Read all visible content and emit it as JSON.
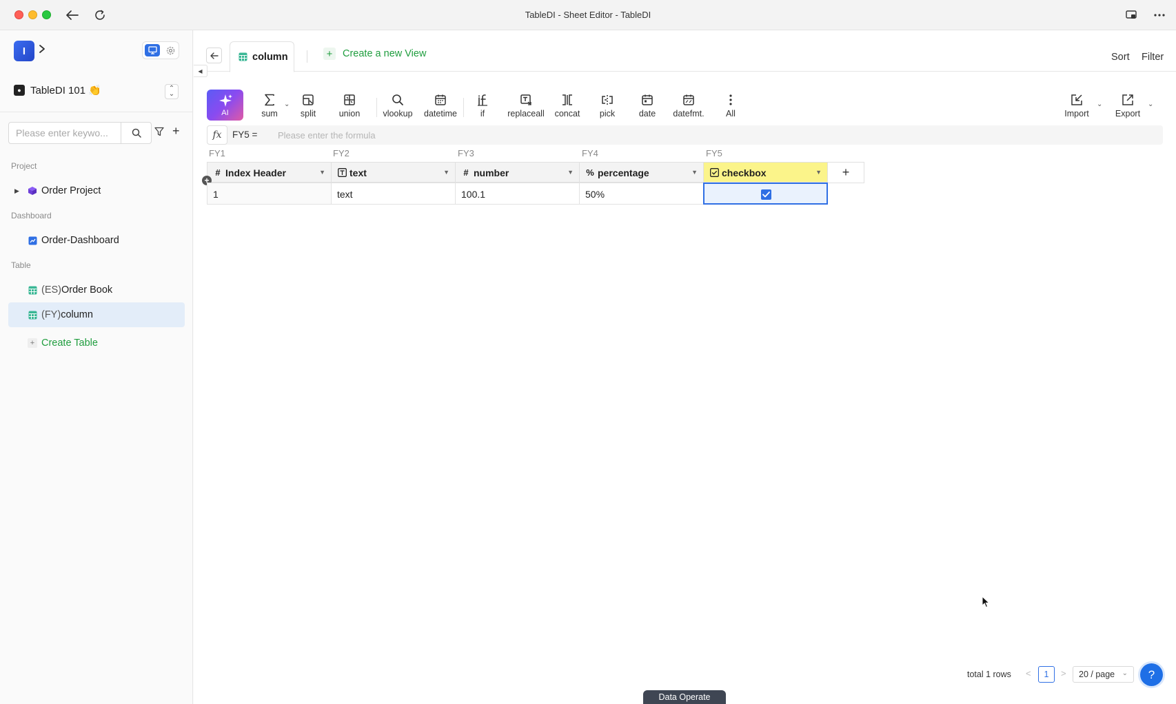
{
  "window": {
    "title": "TableDI - Sheet Editor - TableDI"
  },
  "sidebar": {
    "logo_letter": "I",
    "workspace": {
      "name": "TableDI 101 👏"
    },
    "search": {
      "placeholder": "Please enter keywo..."
    },
    "sections": {
      "project": "Project",
      "dashboard": "Dashboard",
      "table": "Table"
    },
    "project_items": [
      {
        "label": "Order Project",
        "icon": "cube-icon"
      }
    ],
    "dashboard_items": [
      {
        "label": "Order-Dashboard",
        "icon": "chart-icon"
      }
    ],
    "table_items": [
      {
        "prefix": "(ES)",
        "label": "Order Book",
        "icon": "table-icon"
      },
      {
        "prefix": "(FY)",
        "label": "column",
        "icon": "table-icon",
        "active": true
      }
    ],
    "create_table_label": "Create Table"
  },
  "tabs": {
    "active_view": "column",
    "create_view_label": "Create a new View",
    "sort_label": "Sort",
    "filter_label": "Filter"
  },
  "toolbar": {
    "ai_label": "AI",
    "tools": [
      {
        "name": "sum",
        "icon": "sigma-icon"
      },
      {
        "name": "split",
        "icon": "split-icon"
      },
      {
        "name": "union",
        "icon": "union-icon"
      },
      {
        "name": "vlookup",
        "icon": "search-icon"
      },
      {
        "name": "datetime",
        "icon": "calendar-icon"
      },
      {
        "name": "if",
        "icon": "if-icon"
      },
      {
        "name": "replaceall",
        "icon": "replace-icon"
      },
      {
        "name": "concat",
        "icon": "concat-icon"
      },
      {
        "name": "pick",
        "icon": "pick-icon"
      },
      {
        "name": "date",
        "icon": "calendar-icon"
      },
      {
        "name": "datefmt.",
        "icon": "calendar-format-icon"
      },
      {
        "name": "All",
        "icon": "more-vertical-icon"
      }
    ],
    "import_label": "Import",
    "export_label": "Export"
  },
  "formula": {
    "cell_ref": "FY5 =",
    "placeholder": "Please enter the formula",
    "value": ""
  },
  "grid": {
    "column_refs": [
      "FY1",
      "FY2",
      "FY3",
      "FY4",
      "FY5"
    ],
    "columns": [
      {
        "name": "Index Header",
        "type_icon": "#"
      },
      {
        "name": "text",
        "type_icon": "T"
      },
      {
        "name": "number",
        "type_icon": "#"
      },
      {
        "name": "percentage",
        "type_icon": "%"
      },
      {
        "name": "checkbox",
        "type_icon": "☑"
      }
    ],
    "rows": [
      {
        "cells": [
          "1",
          "text",
          "100.1",
          "50%",
          true
        ]
      }
    ],
    "selected_column": "FY5"
  },
  "footer": {
    "total_text": "total 1 rows",
    "current_page": "1",
    "page_size": "20 / page",
    "help_label": "?",
    "data_operate_label": "Data Operate"
  },
  "colors": {
    "accent": "#2f6fe4",
    "create": "#1f9d3e",
    "selected_header": "#fbf48a",
    "selected_cell": "#eaf2fd"
  }
}
